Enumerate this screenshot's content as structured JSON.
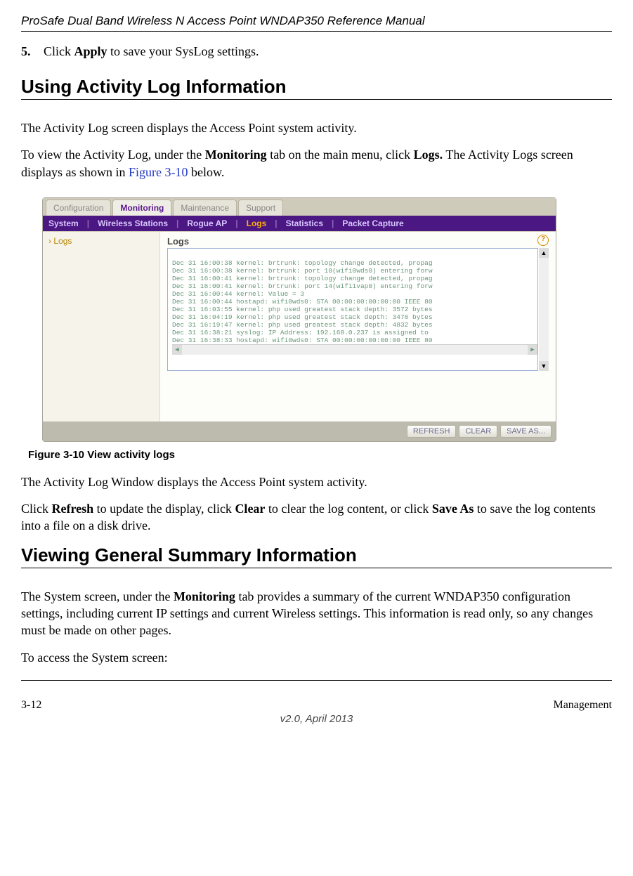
{
  "header": {
    "title": "ProSafe Dual Band Wireless N Access Point WNDAP350 Reference Manual"
  },
  "step5": {
    "num": "5.",
    "text_before": "Click ",
    "apply": "Apply",
    "text_after": " to save your SysLog settings."
  },
  "section1_title": "Using Activity Log Information",
  "para1": "The Activity Log screen displays the Access Point system activity.",
  "para2_parts": {
    "a": "To view the Activity Log, under the ",
    "monitoring": "Monitoring",
    "b": " tab on the main menu, click ",
    "logs": "Logs.",
    "c": " The Activity Logs screen displays as shown in ",
    "fig": "Figure 3-10",
    "d": " below."
  },
  "fig_caption": "Figure 3-10  View activity logs",
  "para3": "The Activity Log Window displays the Access Point system activity.",
  "para4_parts": {
    "a": "Click ",
    "refresh": "Refresh",
    "b": " to update the display, click ",
    "clear": "Clear",
    "c": " to clear the log content, or click ",
    "saveas": "Save As",
    "d": " to save the log contents into a file on a disk drive."
  },
  "section2_title": "Viewing General Summary Information",
  "para5_parts": {
    "a": "The System screen, under the ",
    "monitoring": "Monitoring",
    "b": " tab provides a summary of the current WNDAP350 configuration settings, including current IP settings and current Wireless settings. This information is read only, so any changes must be made on other pages."
  },
  "para6": "To access the System screen:",
  "footer": {
    "left": "3-12",
    "center": "v2.0, April 2013",
    "right": "Management"
  },
  "screenshot": {
    "top_tabs": [
      "Configuration",
      "Monitoring",
      "Maintenance",
      "Support"
    ],
    "top_active_index": 1,
    "sub_tabs": [
      "System",
      "Wireless Stations",
      "Rogue AP",
      "Logs",
      "Statistics",
      "Packet Capture"
    ],
    "sub_active_index": 3,
    "side_item": "Logs",
    "panel_title": "Logs",
    "help_icon": "?",
    "log_lines": [
      "Dec 31 16:00:38 kernel: brtrunk: topology change detected, propag",
      "Dec 31 16:00:38 kernel: brtrunk: port 10(wifi0wds0) entering forw",
      "Dec 31 16:00:41 kernel: brtrunk: topology change detected, propag",
      "Dec 31 16:00:41 kernel: brtrunk: port 14(wifi1vap0) entering forw",
      "Dec 31 16:00:44 kernel: Value = 3",
      "Dec 31 16:00:44 hostapd: wifi0wds0: STA 00:00:00:00:00:00 IEEE 80",
      "Dec 31 16:03:55 kernel: php used greatest stack depth: 3572 bytes",
      "Dec 31 16:04:19 kernel: php used greatest stack depth: 3476 bytes",
      "Dec 31 16:19:47 kernel: php used greatest stack depth: 4832 bytes",
      "Dec 31 16:38:21 syslog: IP Address: 192.168.0.237 is assigned to",
      "Dec 31 16:38:33 hostapd: wifi0wds0: STA 00:00:00:00:00:00 IEEE 80"
    ],
    "buttons": {
      "refresh": "REFRESH",
      "clear": "CLEAR",
      "saveas": "SAVE AS..."
    }
  }
}
